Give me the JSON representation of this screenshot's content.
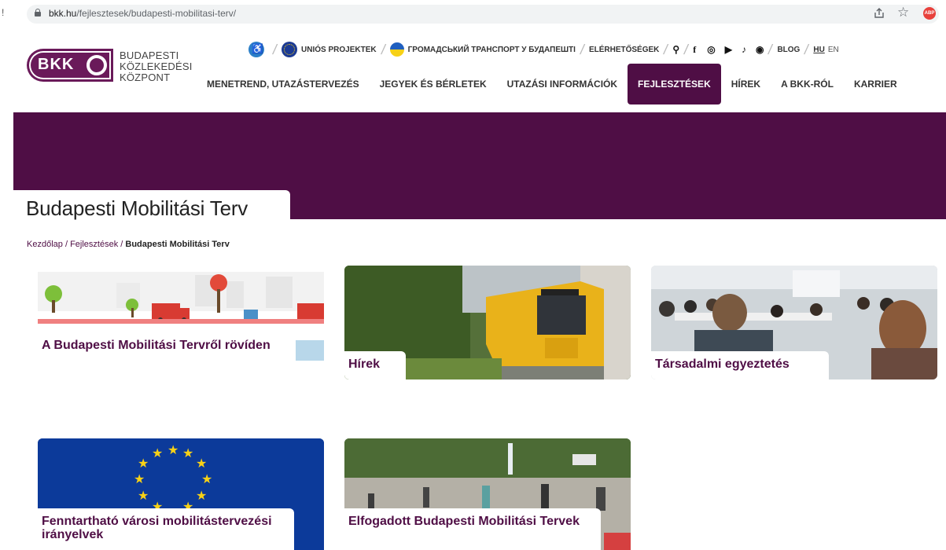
{
  "browser": {
    "edge_mark": "!",
    "url_domain": "bkk.hu",
    "url_path": "/fejlesztesek/budapesti-mobilitasi-terv/"
  },
  "logo": {
    "abbr": "BKK",
    "name_line1": "BUDAPESTI",
    "name_line2": "KÖZLEKEDÉSI",
    "name_line3": "KÖZPONT",
    "color": "#6a1a5a"
  },
  "util_nav": {
    "eu_projects": "UNIÓS PROJEKTEK",
    "ukrainian": "ГРОМАДСЬКИЙ ТРАНСПОРТ У БУДАПЕШТІ",
    "contacts": "ELÉRHETŐSÉGEK",
    "blog": "BLOG",
    "lang_hu": "HU",
    "lang_en": "EN"
  },
  "main_nav": [
    {
      "label": "MENETREND, UTAZÁSTERVEZÉS",
      "active": false
    },
    {
      "label": "JEGYEK ÉS BÉRLETEK",
      "active": false
    },
    {
      "label": "UTAZÁSI INFORMÁCIÓK",
      "active": false
    },
    {
      "label": "FEJLESZTÉSEK",
      "active": true
    },
    {
      "label": "HÍREK",
      "active": false
    },
    {
      "label": "A BKK-RÓL",
      "active": false
    },
    {
      "label": "KARRIER",
      "active": false
    }
  ],
  "hero": {
    "title": "Budapesti Mobilitási Terv",
    "color": "#4f0e45"
  },
  "breadcrumb": {
    "home": "Kezdőlap",
    "section": "Fejlesztések",
    "current": "Budapesti Mobilitási Terv",
    "separator": "/"
  },
  "cards": [
    {
      "title": "A Budapesti Mobilitási Tervről rövíden"
    },
    {
      "title": "Hírek"
    },
    {
      "title": "Társadalmi egyeztetés"
    },
    {
      "title": "Fenntartható városi mobilitástervezési irányelvek"
    },
    {
      "title": "Elfogadott Budapesti Mobilitási Tervek"
    }
  ]
}
